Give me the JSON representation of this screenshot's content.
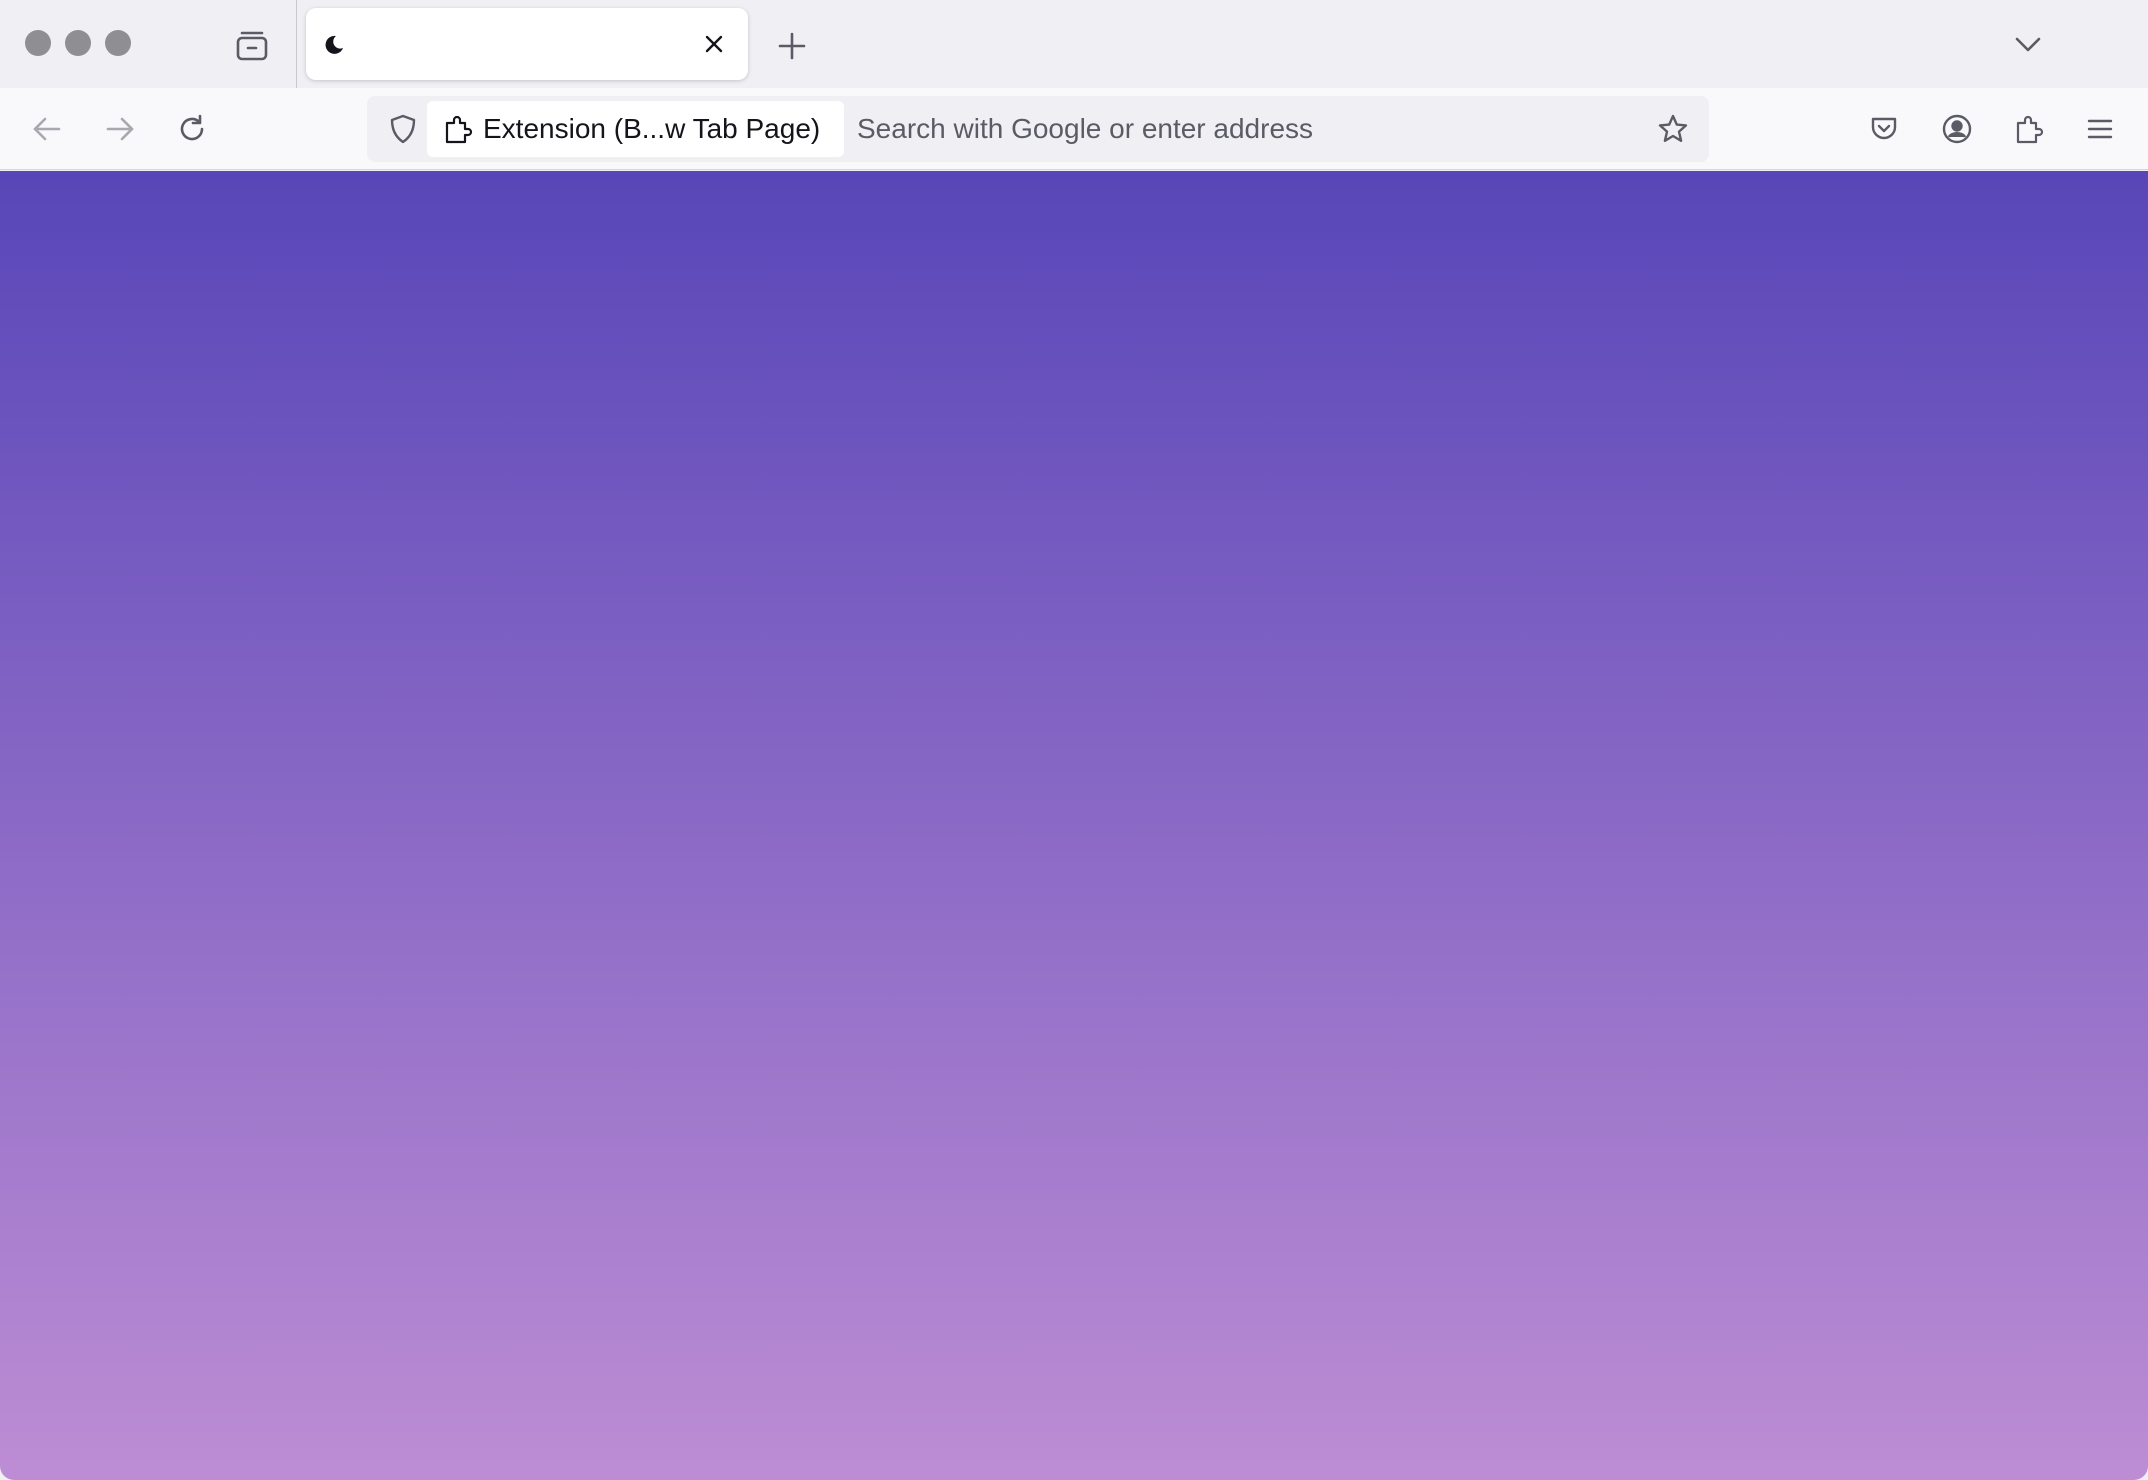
{
  "browser": {
    "colors": {
      "chrome": "#f0eff4",
      "toolbar": "#f9f9fb",
      "urlbar": "#f0f0f4",
      "icon": "#5b5b66",
      "traffic_light": "#8e8e93",
      "gradient_top": "#5846b8",
      "gradient_bottom": "#bd8dd4"
    },
    "tabs": [
      {
        "title": "",
        "favicon": "crescent-moon-icon",
        "active": true
      }
    ],
    "urlbar": {
      "identity_label": "Extension (B...w Tab Page)",
      "identity_icon": "puzzle-piece-icon",
      "placeholder": "Search with Google or enter address",
      "value": ""
    },
    "icons": {
      "tab_manager": "tab-manager-icon",
      "new_tab": "plus-icon",
      "list_tabs": "chevron-down-icon",
      "back": "arrow-left-icon",
      "forward": "arrow-right-icon",
      "reload": "reload-icon",
      "tracking_protection": "shield-icon",
      "bookmark": "star-icon",
      "pocket": "pocket-icon",
      "account": "account-icon",
      "extensions": "puzzle-piece-icon",
      "menu": "hamburger-menu-icon"
    }
  },
  "page": {
    "background": "gradient"
  }
}
